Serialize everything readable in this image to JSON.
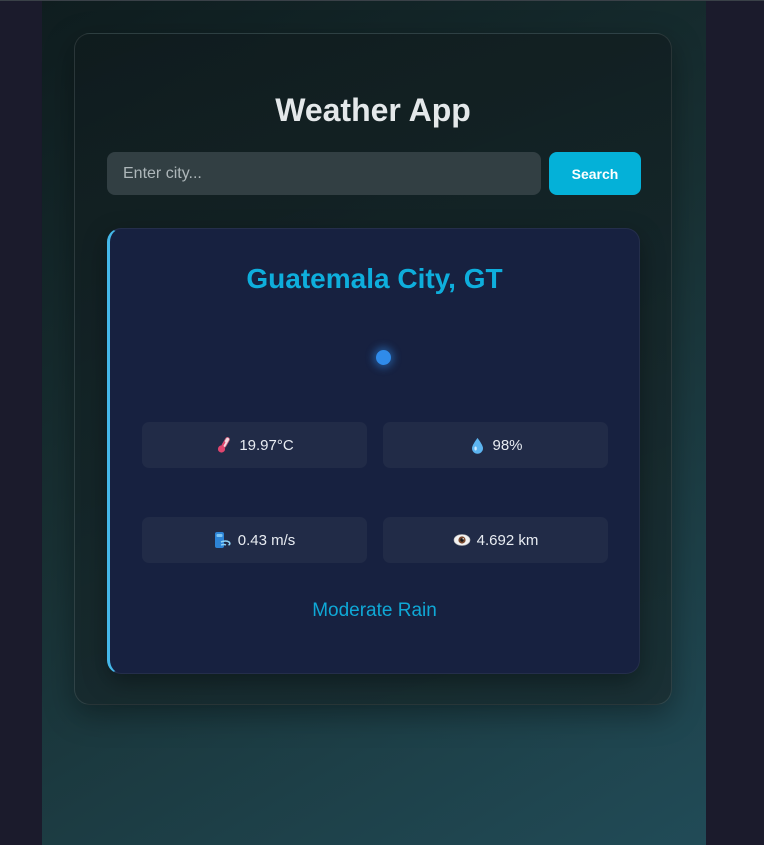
{
  "app": {
    "title": "Weather App"
  },
  "search": {
    "placeholder": "Enter city...",
    "value": "",
    "button_label": "Search"
  },
  "weather": {
    "city": "Guatemala City, GT",
    "temperature": "19.97°C",
    "humidity": "98%",
    "wind": "0.43 m/s",
    "visibility": "4.692 km",
    "condition": "Moderate Rain"
  },
  "icons": {
    "temperature": "thermometer-icon",
    "humidity": "droplet-icon",
    "wind": "wind-icon",
    "visibility": "eye-icon"
  },
  "colors": {
    "accent": "#04b1d8",
    "city": "#0eaedc",
    "card_border": "#45b8ea",
    "indicator": "#2f8bea"
  }
}
